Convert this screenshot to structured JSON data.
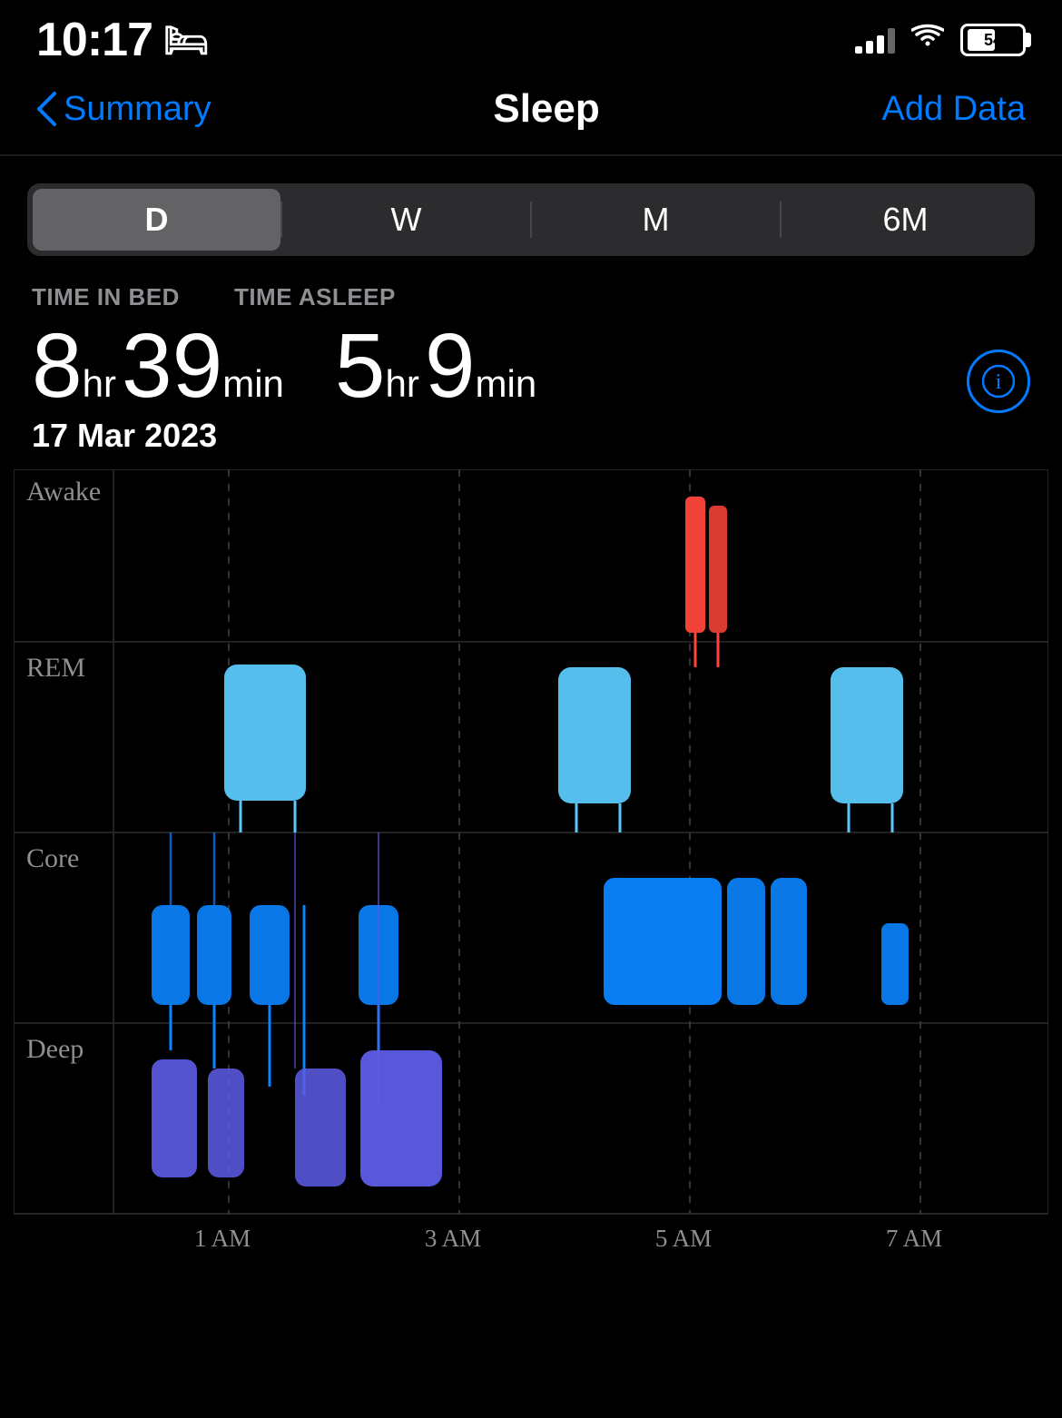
{
  "statusBar": {
    "time": "10:17",
    "battery": "54"
  },
  "nav": {
    "back_label": "Summary",
    "title": "Sleep",
    "action_label": "Add Data"
  },
  "periodSelector": {
    "options": [
      "D",
      "W",
      "M",
      "6M"
    ],
    "active_index": 0
  },
  "stats": {
    "time_in_bed_label": "TIME IN BED",
    "time_asleep_label": "TIME ASLEEP",
    "time_in_bed_hours": "8",
    "time_in_bed_hr_unit": "hr",
    "time_in_bed_minutes": "39",
    "time_in_bed_min_unit": "min",
    "time_asleep_hours": "5",
    "time_asleep_hr_unit": "hr",
    "time_asleep_minutes": "9",
    "time_asleep_min_unit": "min",
    "date": "17 Mar 2023"
  },
  "chart": {
    "rows": [
      "Awake",
      "REM",
      "Core",
      "Deep"
    ],
    "time_labels": [
      "1 AM",
      "3 AM",
      "5 AM",
      "7 AM"
    ]
  },
  "colors": {
    "accent": "#007AFF",
    "background": "#000000",
    "card_bg": "#1c1c1e",
    "awake_color": "#FF453A",
    "rem_color": "#5AC8FA",
    "core_color": "#0A84FF",
    "deep_color": "#5E5CE6"
  }
}
